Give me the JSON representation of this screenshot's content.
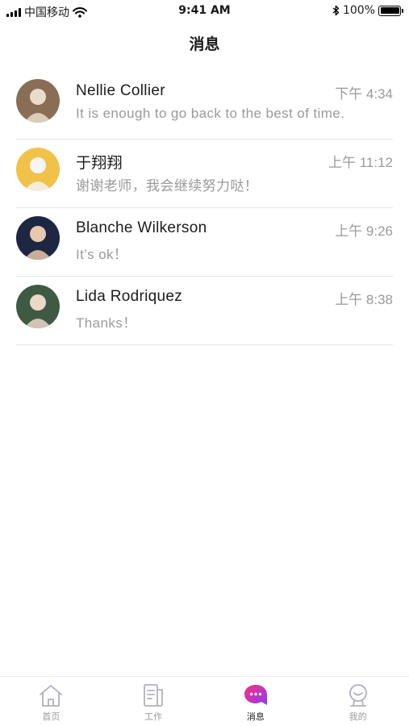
{
  "status_bar": {
    "carrier": "中国移动",
    "time": "9:41 AM",
    "battery": "100%",
    "battery_level": 1.0
  },
  "header": {
    "title": "消息"
  },
  "messages": [
    {
      "name": "Nellie Collier",
      "time": "下午 4:34",
      "preview": "It is enough to go back to the best of time.",
      "avatar_colors": [
        "#8a6d55",
        "#e9dccb"
      ]
    },
    {
      "name": "于翔翔",
      "time": "上午 11:12",
      "preview": "谢谢老师，我会继续努力哒！",
      "avatar_colors": [
        "#f0c24a",
        "#f5f5f5"
      ]
    },
    {
      "name": "Blanche Wilkerson",
      "time": "上午 9:26",
      "preview": "It’s ok！",
      "avatar_colors": [
        "#1d2742",
        "#e8c7ad"
      ]
    },
    {
      "name": "Lida Rodriquez",
      "time": "上午 8:38",
      "preview": "Thanks！",
      "avatar_colors": [
        "#3f5a44",
        "#ead8c9"
      ]
    }
  ],
  "tab_bar": {
    "tabs": [
      {
        "label": "首页",
        "icon": "home-icon"
      },
      {
        "label": "工作",
        "icon": "document-icon"
      },
      {
        "label": "消息",
        "icon": "chat-bubble-icon",
        "active": true
      },
      {
        "label": "我的",
        "icon": "user-icon"
      }
    ],
    "active_gradient": [
      "#ff2e7e",
      "#8a3cf6"
    ],
    "inactive_color": "#b0b0c0"
  }
}
